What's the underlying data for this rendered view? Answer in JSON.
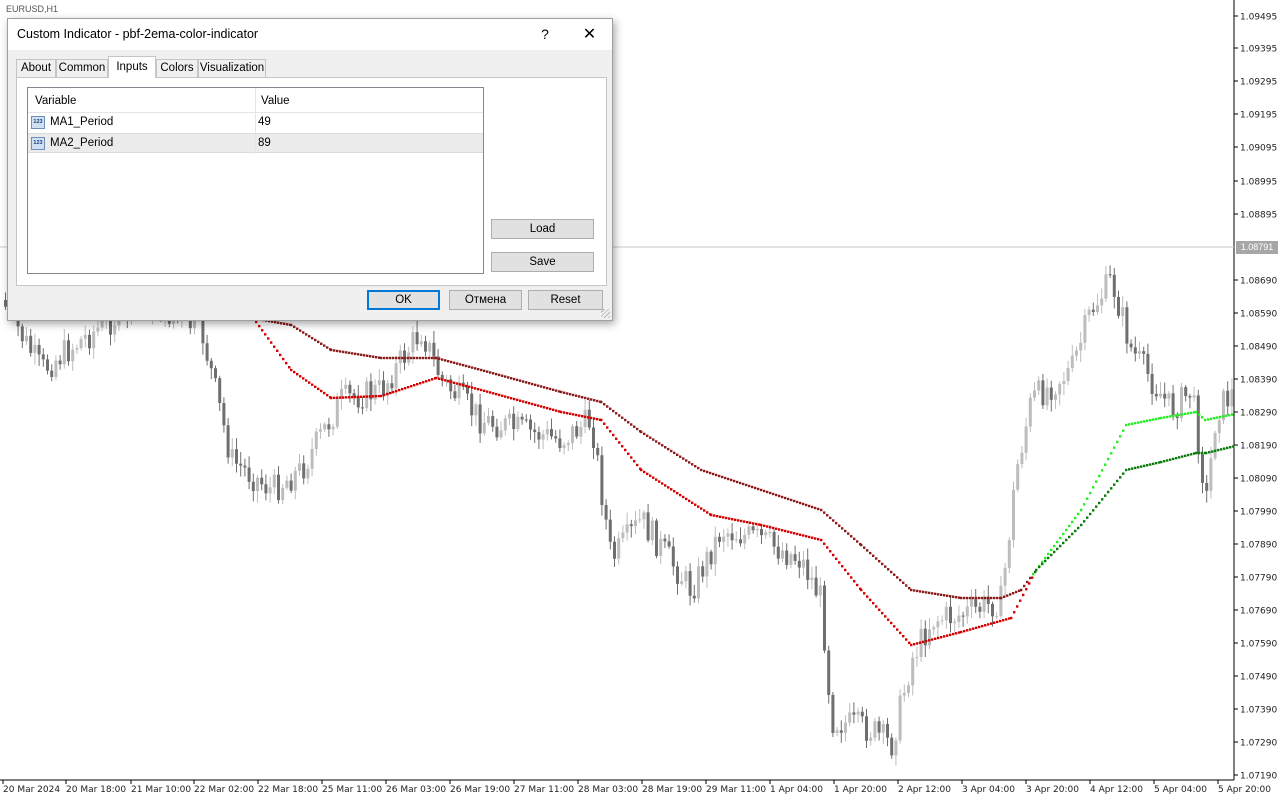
{
  "chart": {
    "symbol_label": "EURUSD,H1",
    "current_price": "1.08791",
    "price_ticks": [
      "1.09495",
      "1.09395",
      "1.09295",
      "1.09195",
      "1.09095",
      "1.08995",
      "1.08895",
      "1.08690",
      "1.08590",
      "1.08490",
      "1.08390",
      "1.08290",
      "1.08190",
      "1.08090",
      "1.07990",
      "1.07890",
      "1.07790",
      "1.07690",
      "1.07590",
      "1.07490",
      "1.07390",
      "1.07290",
      "1.07190"
    ],
    "time_ticks": [
      "20 Mar 2024",
      "20 Mar 18:00",
      "21 Mar 10:00",
      "22 Mar 02:00",
      "22 Mar 18:00",
      "25 Mar 11:00",
      "26 Mar 03:00",
      "26 Mar 19:00",
      "27 Mar 11:00",
      "28 Mar 03:00",
      "28 Mar 19:00",
      "29 Mar 11:00",
      "1 Apr 04:00",
      "1 Apr 20:00",
      "2 Apr 12:00",
      "3 Apr 04:00",
      "3 Apr 20:00",
      "4 Apr 12:00",
      "5 Apr 04:00",
      "5 Apr 20:00"
    ],
    "colors": {
      "bull": "#bdbdbd",
      "bear": "#6f6f6f",
      "ma_down_fast": "#8b1a1a",
      "ma_down_slow": "#d40000",
      "ma_up_fast": "#22ee22",
      "ma_up_slow": "#0a7a0a"
    }
  },
  "dialog": {
    "title": "Custom Indicator - pbf-2ema-color-indicator",
    "help_label": "?",
    "close_label": "✕",
    "tabs": [
      {
        "label": "About"
      },
      {
        "label": "Common"
      },
      {
        "label": "Inputs"
      },
      {
        "label": "Colors"
      },
      {
        "label": "Visualization"
      }
    ],
    "active_tab": "Inputs",
    "grid": {
      "col_variable": "Variable",
      "col_value": "Value",
      "rows": [
        {
          "icon": "123",
          "variable": "MA1_Period",
          "value": "49"
        },
        {
          "icon": "123",
          "variable": "MA2_Period",
          "value": "89"
        }
      ]
    },
    "buttons": {
      "load": "Load",
      "save": "Save",
      "ok": "OK",
      "cancel": "Отмена",
      "reset": "Reset"
    }
  }
}
